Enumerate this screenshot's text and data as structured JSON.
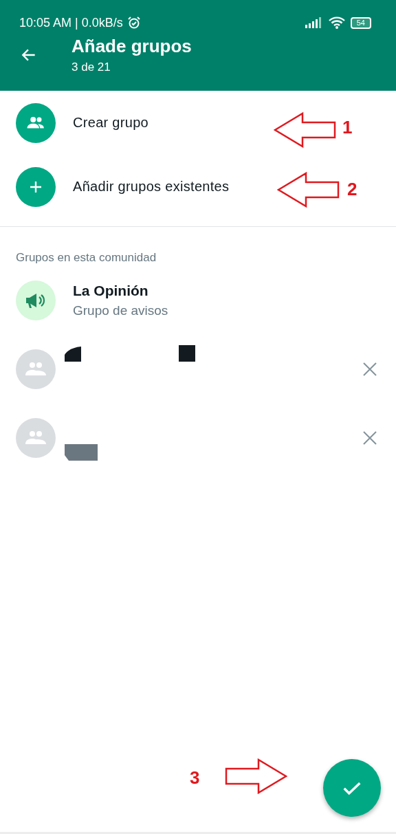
{
  "status_bar": {
    "time": "10:05 AM | 0.0kB/s",
    "battery": "54"
  },
  "header": {
    "title": "Añade grupos",
    "subtitle": "3 de 21"
  },
  "actions": [
    {
      "kind": "create",
      "label": "Crear grupo"
    },
    {
      "kind": "add",
      "label": "Añadir grupos existentes"
    }
  ],
  "section_label": "Grupos en esta comunidad",
  "groups": [
    {
      "kind": "announcement",
      "name": "La Opinión",
      "subtitle": "Grupo de avisos"
    },
    {
      "kind": "redacted"
    },
    {
      "kind": "redacted"
    }
  ],
  "annotations": [
    {
      "label": "1",
      "kind": "leftarrow"
    },
    {
      "label": "2",
      "kind": "leftarrow"
    },
    {
      "label": "3",
      "kind": "rightarrow"
    }
  ]
}
